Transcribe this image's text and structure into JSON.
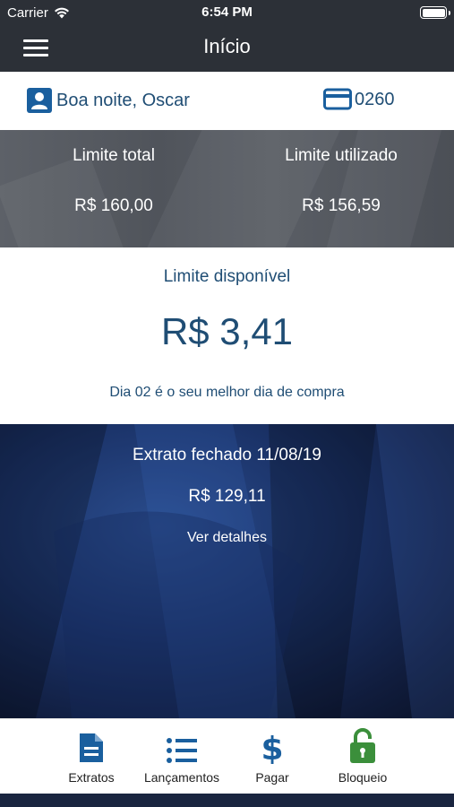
{
  "status": {
    "carrier": "Carrier",
    "time": "6:54 PM"
  },
  "nav": {
    "title": "Início"
  },
  "greeting": {
    "text": "Boa noite, Oscar",
    "card_last_digits": "0260"
  },
  "limits": {
    "total_label": "Limite total",
    "total_value": "R$ 160,00",
    "used_label": "Limite utilizado",
    "used_value": "R$ 156,59"
  },
  "available": {
    "label": "Limite disponível",
    "amount": "R$ 3,41",
    "tip": "Dia 02 é o seu melhor dia de compra"
  },
  "statement": {
    "title": "Extrato fechado 11/08/19",
    "amount": "R$ 129,11",
    "link": "Ver detalhes"
  },
  "tabs": [
    {
      "label": "Extratos",
      "icon": "document-icon"
    },
    {
      "label": "Lançamentos",
      "icon": "list-icon"
    },
    {
      "label": "Pagar",
      "icon": "dollar-icon"
    },
    {
      "label": "Bloqueio",
      "icon": "lock-icon"
    }
  ],
  "colors": {
    "brand_blue": "#1a5f9e",
    "text_blue": "#1f4d74",
    "lock_green": "#3b8f3b",
    "navbar": "#2c3037"
  }
}
